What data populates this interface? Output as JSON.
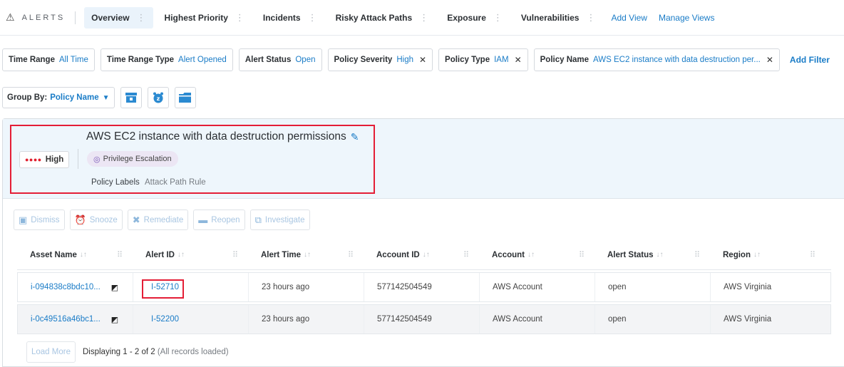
{
  "nav": {
    "brand": "ALERTS",
    "tabs": [
      {
        "label": "Overview"
      },
      {
        "label": "Highest Priority"
      },
      {
        "label": "Incidents"
      },
      {
        "label": "Risky Attack Paths"
      },
      {
        "label": "Exposure"
      },
      {
        "label": "Vulnerabilities"
      }
    ],
    "add_view": "Add View",
    "manage_views": "Manage Views"
  },
  "filters": {
    "time_range": {
      "label": "Time Range",
      "value": "All Time"
    },
    "time_range_type": {
      "label": "Time Range Type",
      "value": "Alert Opened"
    },
    "alert_status": {
      "label": "Alert Status",
      "value": "Open"
    },
    "policy_severity": {
      "label": "Policy Severity",
      "value": "High"
    },
    "policy_type": {
      "label": "Policy Type",
      "value": "IAM"
    },
    "policy_name": {
      "label": "Policy Name",
      "value": "AWS EC2 instance with data destruction per..."
    },
    "add_filter": "Add Filter"
  },
  "group": {
    "label": "Group By:",
    "value": "Policy Name"
  },
  "policy": {
    "severity": "High",
    "title": "AWS EC2 instance with data destruction permissions",
    "category": "Privilege Escalation",
    "labels_label": "Policy Labels",
    "labels_value": "Attack Path Rule"
  },
  "actions": {
    "dismiss": "Dismiss",
    "snooze": "Snooze",
    "remediate": "Remediate",
    "reopen": "Reopen",
    "investigate": "Investigate"
  },
  "table": {
    "columns": [
      "Asset Name",
      "Alert ID",
      "Alert Time",
      "Account ID",
      "Account",
      "Alert Status",
      "Region"
    ],
    "rows": [
      {
        "asset": "i-094838c8bdc10...",
        "alert_id": "I-52710",
        "time": "23 hours ago",
        "account_id": "577142504549",
        "account": "AWS Account",
        "status": "open",
        "region": "AWS Virginia"
      },
      {
        "asset": "i-0c49516a46bc1...",
        "alert_id": "I-52200",
        "time": "23 hours ago",
        "account_id": "577142504549",
        "account": "AWS Account",
        "status": "open",
        "region": "AWS Virginia"
      }
    ]
  },
  "footer": {
    "load_more": "Load More",
    "displaying": "Displaying 1 - 2 of 2",
    "loaded": "(All records loaded)"
  },
  "colors": {
    "accent": "#1a7cc7",
    "highlight": "#e41e36",
    "severity_high": "#e0202f"
  }
}
